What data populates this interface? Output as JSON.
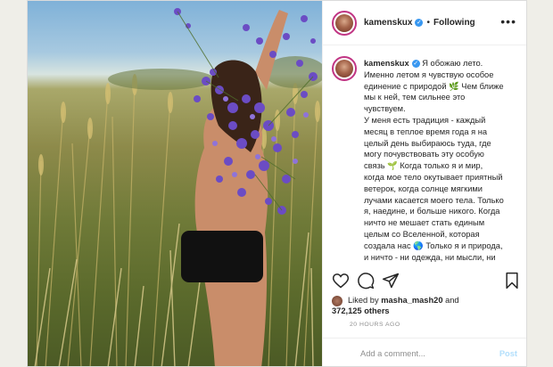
{
  "post": {
    "username": "kamenskux",
    "follow_label": "Following",
    "caption_username": "kamenskux",
    "caption_lines": [
      "Я обожаю лето.",
      "Именно летом я чувствую особое",
      "единение с природой 🌿 Чем ближе",
      "мы к ней, тем сильнее это",
      "чувствуем.",
      "У меня есть традиция - каждый",
      "месяц в теплое время года я на",
      "целый день выбираюсь туда, где",
      "могу почувствовать эту особую",
      "связь 🌱 Когда только я и мир,",
      "когда мое тело окутывает приятный",
      "ветерок, когда солнце мягкими",
      "лучами касается моего тела. Только",
      "я, наедине, и больше никого. Когда",
      "ничто не мешает стать единым",
      "целым со Вселенной, которая",
      "создала нас 🌎 Только я и природа,",
      "и ничто - ни одежда, ни мысли, ни"
    ],
    "likes_prefix": "Liked by",
    "likes_user": "masha_mash20",
    "likes_and": "and",
    "likes_count": "372,125 others",
    "timestamp": "20 HOURS AGO",
    "comment_placeholder": "Add a comment...",
    "post_label": "Post"
  },
  "icons": [
    "more-options-icon",
    "heart-icon",
    "comment-icon",
    "share-icon",
    "bookmark-icon",
    "verified-icon"
  ],
  "colors": {
    "link_blue": "#3897f0",
    "post_disabled": "#b2dffc",
    "text": "#262626",
    "muted": "#8e8e8e"
  }
}
